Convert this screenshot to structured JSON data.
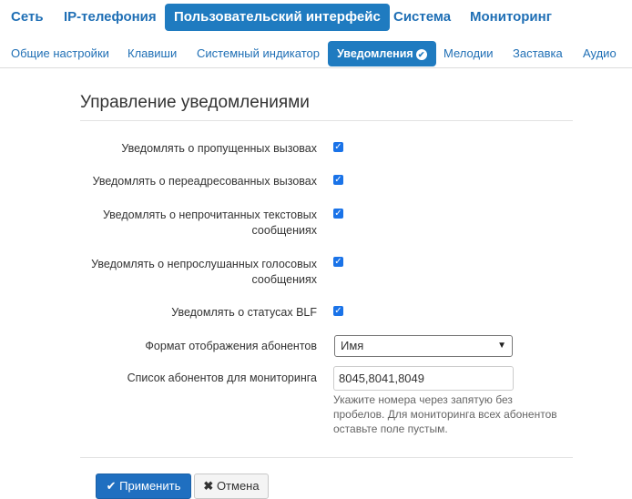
{
  "top_nav": {
    "items": [
      {
        "label": "Сеть"
      },
      {
        "label": "IP-телефония"
      },
      {
        "label": "Пользовательский интерфейс",
        "active": true
      },
      {
        "label": "Система"
      },
      {
        "label": "Мониторинг"
      }
    ]
  },
  "sub_nav": {
    "items": [
      {
        "label": "Общие настройки"
      },
      {
        "label": "Клавиши"
      },
      {
        "label": "Системный индикатор"
      },
      {
        "label": "Уведомления",
        "active": true,
        "icon": "check-circle-icon"
      },
      {
        "label": "Мелодии"
      },
      {
        "label": "Заставка"
      },
      {
        "label": "Аудио"
      }
    ]
  },
  "section": {
    "title": "Управление уведомлениями"
  },
  "form": {
    "notify_missed": {
      "label": "Уведомлять о пропущенных вызовах",
      "checked": true
    },
    "notify_forwarded": {
      "label": "Уведомлять о переадресованных вызовах",
      "checked": true
    },
    "notify_unread_sms": {
      "label_line1": "Уведомлять о непрочитанных текстовых",
      "label_line2": "сообщениях",
      "checked": true
    },
    "notify_unheard_voice": {
      "label_line1": "Уведомлять о непрослушанных голосовых",
      "label_line2": "сообщениях",
      "checked": true
    },
    "notify_blf": {
      "label": "Уведомлять о статусах BLF",
      "checked": true
    },
    "display_format": {
      "label": "Формат отображения абонентов",
      "value": "Имя"
    },
    "monitor_list": {
      "label": "Список абонентов для мониторинга",
      "value": "8045,8041,8049",
      "help_line1": "Укажите номера через запятую без",
      "help_line2": "пробелов. Для мониторинга всех абонентов",
      "help_line3": "оставьте поле пустым."
    }
  },
  "buttons": {
    "apply": "Применить",
    "cancel": "Отмена"
  },
  "colors": {
    "accent": "#1f7bc0",
    "link": "#1f6fb5",
    "checkbox": "#1a73e8"
  }
}
